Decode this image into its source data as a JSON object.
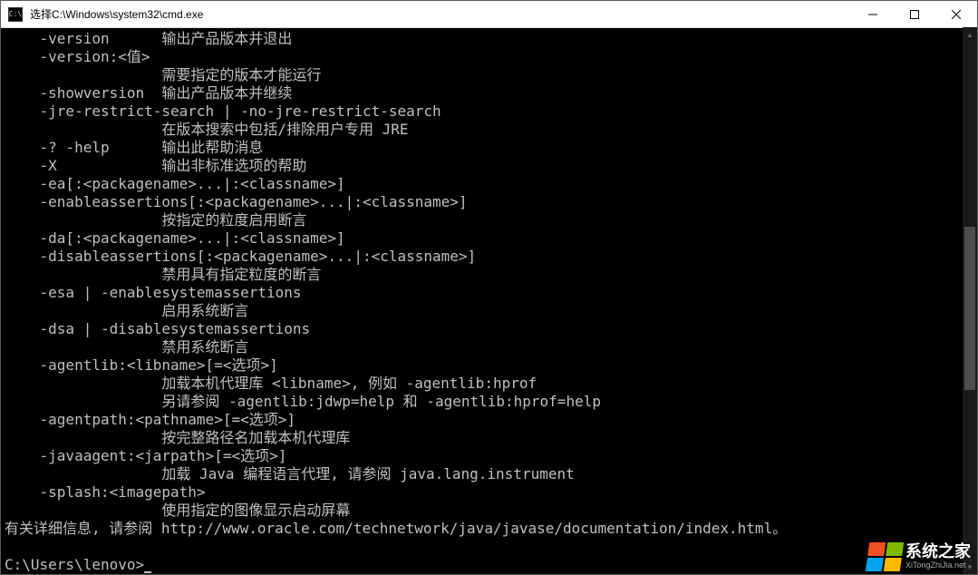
{
  "window": {
    "title": "选择C:\\Windows\\system32\\cmd.exe",
    "icon_label": "C:\\"
  },
  "terminal": {
    "lines": [
      "    -version      输出产品版本并退出",
      "    -version:<值>",
      "                  需要指定的版本才能运行",
      "    -showversion  输出产品版本并继续",
      "    -jre-restrict-search | -no-jre-restrict-search",
      "                  在版本搜索中包括/排除用户专用 JRE",
      "    -? -help      输出此帮助消息",
      "    -X            输出非标准选项的帮助",
      "    -ea[:<packagename>...|:<classname>]",
      "    -enableassertions[:<packagename>...|:<classname>]",
      "                  按指定的粒度启用断言",
      "    -da[:<packagename>...|:<classname>]",
      "    -disableassertions[:<packagename>...|:<classname>]",
      "                  禁用具有指定粒度的断言",
      "    -esa | -enablesystemassertions",
      "                  启用系统断言",
      "    -dsa | -disablesystemassertions",
      "                  禁用系统断言",
      "    -agentlib:<libname>[=<选项>]",
      "                  加载本机代理库 <libname>, 例如 -agentlib:hprof",
      "                  另请参阅 -agentlib:jdwp=help 和 -agentlib:hprof=help",
      "    -agentpath:<pathname>[=<选项>]",
      "                  按完整路径名加载本机代理库",
      "    -javaagent:<jarpath>[=<选项>]",
      "                  加载 Java 编程语言代理, 请参阅 java.lang.instrument",
      "    -splash:<imagepath>",
      "                  使用指定的图像显示启动屏幕",
      "有关详细信息, 请参阅 http://www.oracle.com/technetwork/java/javase/documentation/index.html。",
      ""
    ],
    "prompt": "C:\\Users\\lenovo>"
  },
  "watermark": {
    "text": "系统之家",
    "sub": "XiTongZhiJia.net"
  }
}
